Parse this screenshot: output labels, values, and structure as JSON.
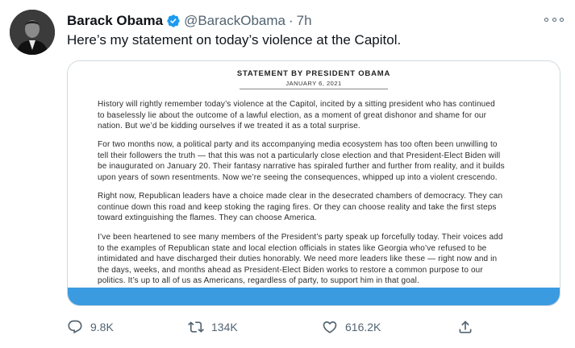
{
  "tweet": {
    "author_name": "Barack Obama",
    "handle": "@BarackObama",
    "separator": "·",
    "time": "7h",
    "text": "Here’s my statement on today’s violence at the Capitol."
  },
  "statement": {
    "title": "STATEMENT BY PRESIDENT OBAMA",
    "date": "JANUARY 6, 2021",
    "paragraphs": [
      [
        "History will rightly remember today’s violence at the Capitol, incited by a sitting president who has continued",
        "to baselessly lie about the outcome of a lawful election, as a moment of great dishonor and shame for our",
        "nation. But we’d be kidding ourselves if we treated it as a total surprise."
      ],
      [
        "For two months now, a political party and its accompanying media ecosystem has too often been unwilling to",
        "tell their followers the truth — that this was not a particularly close election and that President-Elect Biden will",
        "be inaugurated on January 20. Their fantasy narrative has spiraled further and further from reality, and it builds",
        "upon years of sown resentments. Now we’re seeing the consequences, whipped up into a violent crescendo."
      ],
      [
        "Right now, Republican leaders have a choice made clear in the desecrated chambers of democracy. They can",
        "continue down this road and keep stoking the raging fires. Or they can choose reality and take the first steps",
        "toward extinguishing the flames. They can choose America."
      ],
      [
        "I’ve been heartened to see many members of the President’s party speak up forcefully today. Their voices add",
        "to the examples of Republican state and local election officials in states like Georgia who’ve refused to be",
        "intimidated and have discharged their duties honorably. We need more leaders like these — right now and in",
        "the days, weeks, and months ahead as President-Elect Biden works to restore a common purpose to our",
        "politics. It’s up to all of us as Americans, regardless of party, to support him in that goal."
      ]
    ]
  },
  "actions": {
    "reply_count": "9.8K",
    "retweet_count": "134K",
    "like_count": "616.2K"
  },
  "icons": {
    "verified": "verified-badge-icon",
    "more": "more-options-icon",
    "reply": "reply-icon",
    "retweet": "retweet-icon",
    "like": "heart-icon",
    "share": "share-icon"
  },
  "colors": {
    "verified_blue": "#1d9bf0",
    "secondary_text": "#536471",
    "statement_bar": "#3a9be0"
  }
}
